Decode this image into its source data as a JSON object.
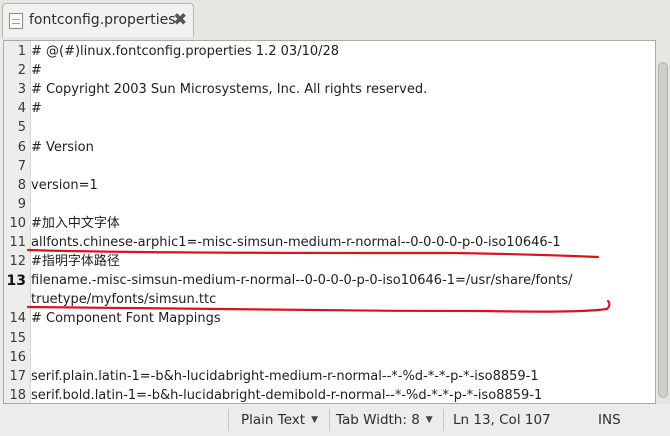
{
  "tab": {
    "title": "fontconfig.properties",
    "icon": "text-file-icon",
    "close_glyph": "✖"
  },
  "editor": {
    "lines": [
      {
        "num": "1",
        "text": "# @(#)linux.fontconfig.properties  1.2 03/10/28"
      },
      {
        "num": "2",
        "text": "#"
      },
      {
        "num": "3",
        "text": "# Copyright 2003 Sun Microsystems, Inc. All rights reserved."
      },
      {
        "num": "4",
        "text": "#"
      },
      {
        "num": "5",
        "text": ""
      },
      {
        "num": "6",
        "text": "# Version"
      },
      {
        "num": "7",
        "text": ""
      },
      {
        "num": "8",
        "text": "version=1"
      },
      {
        "num": "9",
        "text": ""
      },
      {
        "num": "10",
        "text": "#加入中文字体"
      },
      {
        "num": "11",
        "text": "allfonts.chinese-arphic1=-misc-simsun-medium-r-normal--0-0-0-0-p-0-iso10646-1"
      },
      {
        "num": "12",
        "text": "#指明字体路径"
      },
      {
        "num": "13",
        "text": "filename.-misc-simsun-medium-r-normal--0-0-0-0-p-0-iso10646-1=/usr/share/fonts/"
      },
      {
        "num": "",
        "text": "truetype/myfonts/simsun.ttc"
      },
      {
        "num": "14",
        "text": "# Component Font Mappings"
      },
      {
        "num": "15",
        "text": ""
      },
      {
        "num": "16",
        "text": ""
      },
      {
        "num": "17",
        "text": "serif.plain.latin-1=-b&h-lucidabright-medium-r-normal--*-%d-*-*-p-*-iso8859-1"
      },
      {
        "num": "18",
        "text": "serif.bold.latin-1=-b&h-lucidabright-demibold-r-normal--*-%d-*-*-p-*-iso8859-1"
      }
    ],
    "current_line": "13",
    "annotation_color": "#d9141b"
  },
  "statusbar": {
    "language": "Plain Text",
    "tab_width": "Tab Width:  8",
    "position": "Ln 13, Col 107",
    "mode": "INS"
  }
}
